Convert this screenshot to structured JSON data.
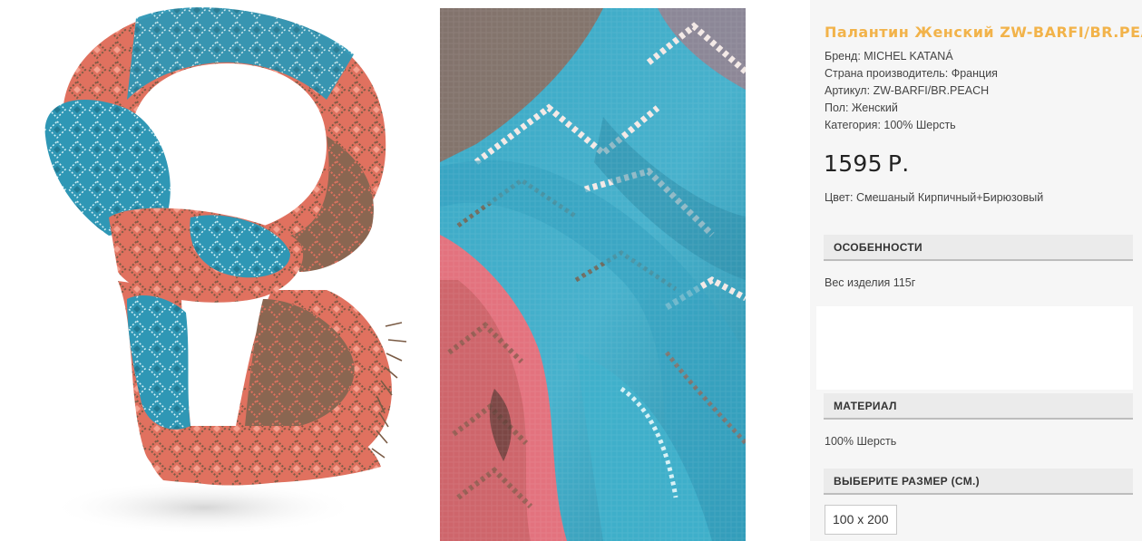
{
  "product": {
    "title": "Палантин Женский ZW-BARFI/BR.PEACH",
    "specs": [
      {
        "label": "Бренд",
        "value": "MICHEL KATANÁ"
      },
      {
        "label": "Страна производитель",
        "value": "Франция"
      },
      {
        "label": "Артикул",
        "value": "ZW-BARFI/BR.PEACH"
      },
      {
        "label": "Пол",
        "value": "Женский"
      },
      {
        "label": "Категория",
        "value": "100% Шерсть"
      }
    ],
    "price": {
      "amount": "1595",
      "currency": "Р."
    },
    "color": {
      "label": "Цвет",
      "value": "Смешаный Кирпичный+Бирюзовый"
    }
  },
  "sections": {
    "features": {
      "header": "ОСОБЕННОСТИ",
      "body": "Вес изделия 115г"
    },
    "material": {
      "header": "МАТЕРИАЛ",
      "body": "100% Шерсть"
    },
    "size": {
      "header": "ВЫБЕРИТЕ РАЗМЕР (СМ.)",
      "options": [
        "100 x 200"
      ]
    }
  },
  "images": {
    "main": "scarf-knot-photo",
    "detail": "scarf-fabric-closeup-photo"
  },
  "colors": {
    "title_accent": "#f2b34a",
    "section_bg": "#ebebeb",
    "panel_bg": "#f6f6f6",
    "scarf_turquoise": "#2f97b5",
    "scarf_brick": "#e0715f",
    "scarf_brown": "#7a5b45"
  }
}
